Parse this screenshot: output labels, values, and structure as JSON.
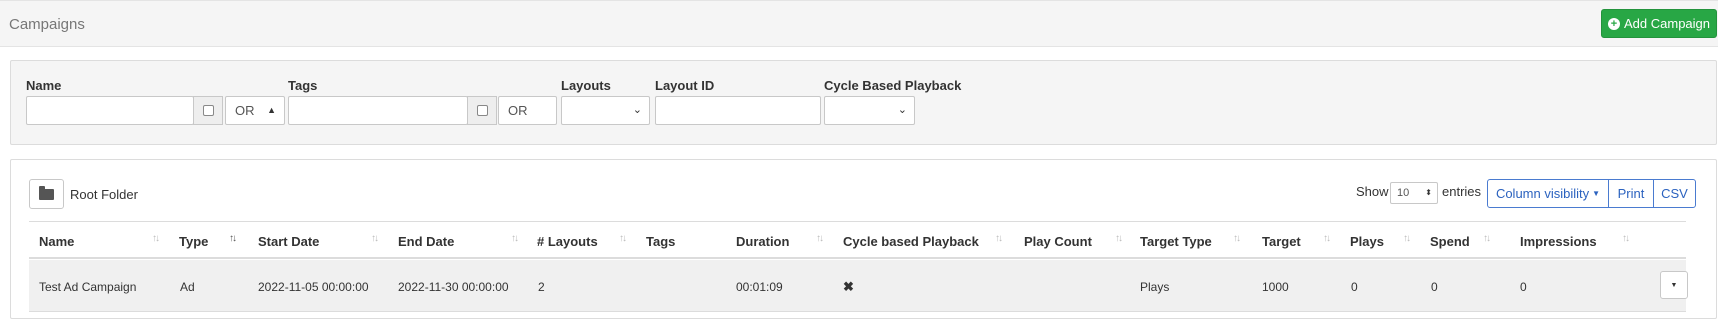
{
  "header": {
    "title": "Campaigns",
    "add_button_label": "Add Campaign"
  },
  "filters": {
    "name_label": "Name",
    "name_value": "",
    "name_logic": "OR",
    "tags_label": "Tags",
    "tags_value": "",
    "tags_logic": "OR",
    "layouts_label": "Layouts",
    "layouts_value": "",
    "layout_id_label": "Layout ID",
    "layout_id_value": "",
    "cycle_label": "Cycle Based Playback",
    "cycle_value": ""
  },
  "toolbar": {
    "folder_label": "Root Folder",
    "show_label": "Show",
    "page_length": "10",
    "entries_label": "entries",
    "column_visibility_label": "Column visibility",
    "print_label": "Print",
    "csv_label": "CSV"
  },
  "table": {
    "columns": [
      "Name",
      "Type",
      "Start Date",
      "End Date",
      "# Layouts",
      "Tags",
      "Duration",
      "Cycle based Playback",
      "Play Count",
      "Target Type",
      "Target",
      "Plays",
      "Spend",
      "Impressions"
    ],
    "rows": [
      {
        "name": "Test Ad Campaign",
        "type": "Ad",
        "start_date": "2022-11-05 00:00:00",
        "end_date": "2022-11-30 00:00:00",
        "layouts": "2",
        "tags": "",
        "duration": "00:01:09",
        "cycle": "✖",
        "play_count": "",
        "target_type": "Plays",
        "target": "1000",
        "plays": "0",
        "spend": "0",
        "impressions": "0"
      }
    ]
  },
  "icons": {
    "add": "plus-circle-icon",
    "folder": "folder-icon",
    "sort": "sort-icon",
    "row_menu": "caret-down-icon",
    "cycle_false": "x-mark-icon"
  },
  "colors": {
    "add_button": "#28a745",
    "dt_buttons": "#2b62bf"
  }
}
